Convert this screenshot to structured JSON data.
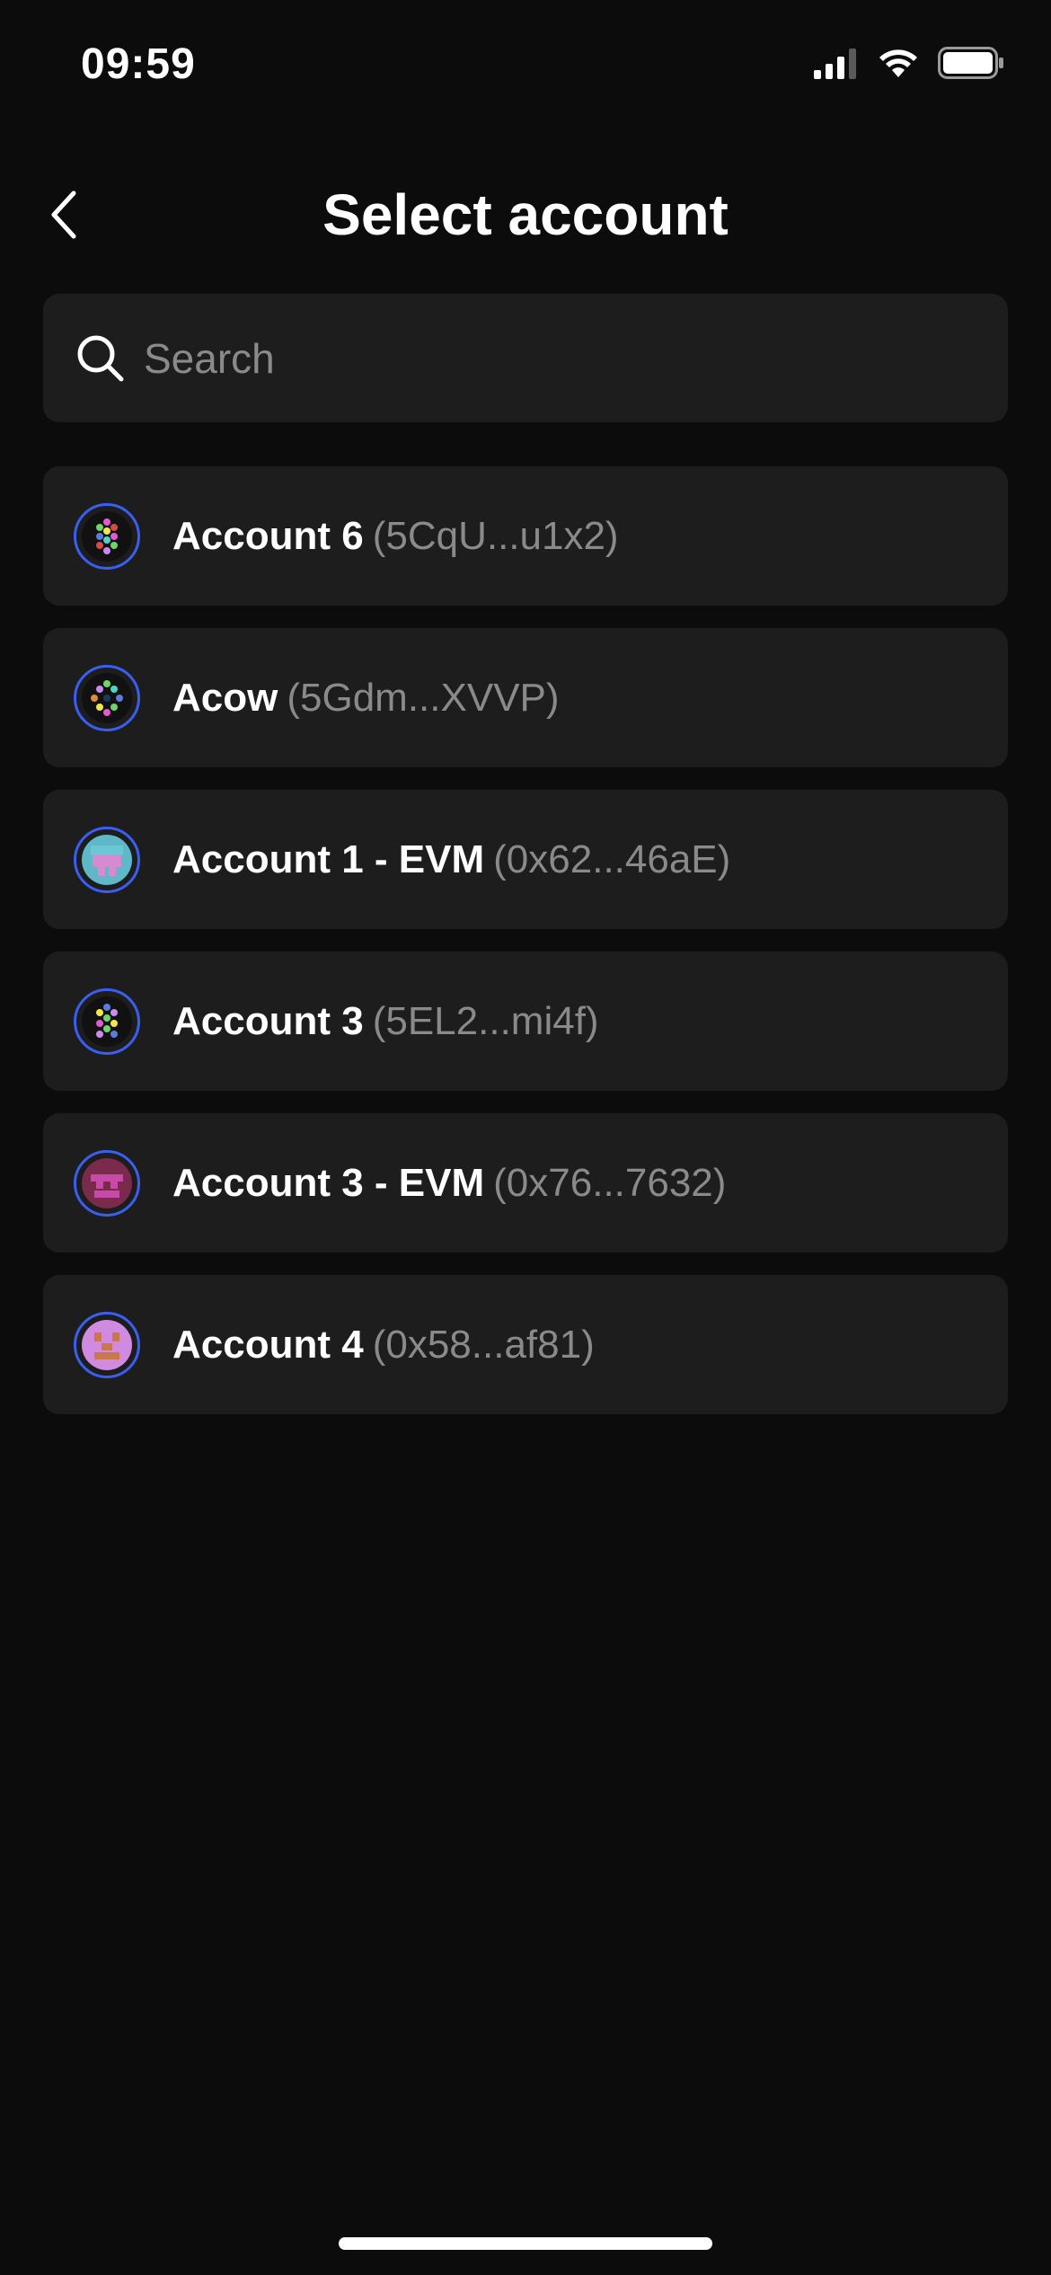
{
  "status_bar": {
    "time": "09:59",
    "icons": [
      "cellular-signal-icon",
      "wifi-icon",
      "battery-icon"
    ]
  },
  "header": {
    "title": "Select account",
    "back_icon": "chevron-left-icon"
  },
  "search": {
    "placeholder": "Search",
    "value": "",
    "icon": "search-icon"
  },
  "accounts": [
    {
      "name": "Account 6",
      "address": "(5CqU...u1x2)",
      "avatar": "dot-identicon"
    },
    {
      "name": "Acow",
      "address": "(5Gdm...XVVP)",
      "avatar": "dot-identicon"
    },
    {
      "name": "Account 1 - EVM",
      "address": "(0x62...46aE)",
      "avatar": "pixel-identicon"
    },
    {
      "name": "Account 3",
      "address": "(5EL2...mi4f)",
      "avatar": "dot-identicon"
    },
    {
      "name": "Account 3 - EVM",
      "address": "(0x76...7632)",
      "avatar": "pixel-identicon"
    },
    {
      "name": "Account 4",
      "address": "(0x58...af81)",
      "avatar": "pixel-identicon"
    }
  ],
  "colors": {
    "background": "#0c0c0c",
    "card": "#1d1d1d",
    "avatar_ring": "#3a5ef0",
    "secondary_text": "#8a8a8a"
  }
}
